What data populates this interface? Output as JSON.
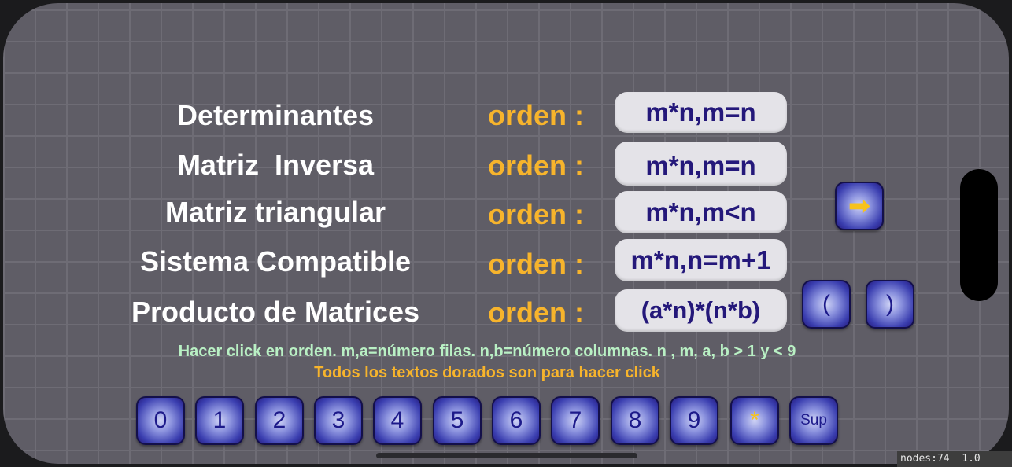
{
  "rows": [
    {
      "label": "Determinantes",
      "orden": "orden :",
      "order": "m*n,m=n"
    },
    {
      "label": "Matriz  Inversa",
      "orden": "orden :",
      "order": "m*n,m=n"
    },
    {
      "label": "Matriz triangular",
      "orden": "orden :",
      "order": "m*n,m<n"
    },
    {
      "label": "Sistema Compatible",
      "orden": "orden :",
      "order": "m*n,n=m+1"
    },
    {
      "label": "Producto de Matrices",
      "orden": "orden :",
      "order": "(a*n)*(n*b)"
    }
  ],
  "next_button": {
    "icon": "arrow-right-icon",
    "glyph": "➡"
  },
  "paren_buttons": {
    "open": "(",
    "close": ")"
  },
  "hints": {
    "instructions": "Hacer click en orden.  m,a=número filas.  n,b=número columnas. n , m, a, b > 1 y < 9",
    "gold_note": "Todos los textos dorados son para hacer click"
  },
  "keypad": [
    "0",
    "1",
    "2",
    "3",
    "4",
    "5",
    "6",
    "7",
    "8",
    "9",
    "*",
    "Sup"
  ],
  "debug": {
    "nodes": "nodes:74",
    "fps": "1.0"
  },
  "colors": {
    "background": "#5f5d66",
    "gold": "#f7b42c",
    "hint_green": "#b9f0c4",
    "pill_text": "#24187a",
    "key_blue": "#3b3fb0"
  }
}
